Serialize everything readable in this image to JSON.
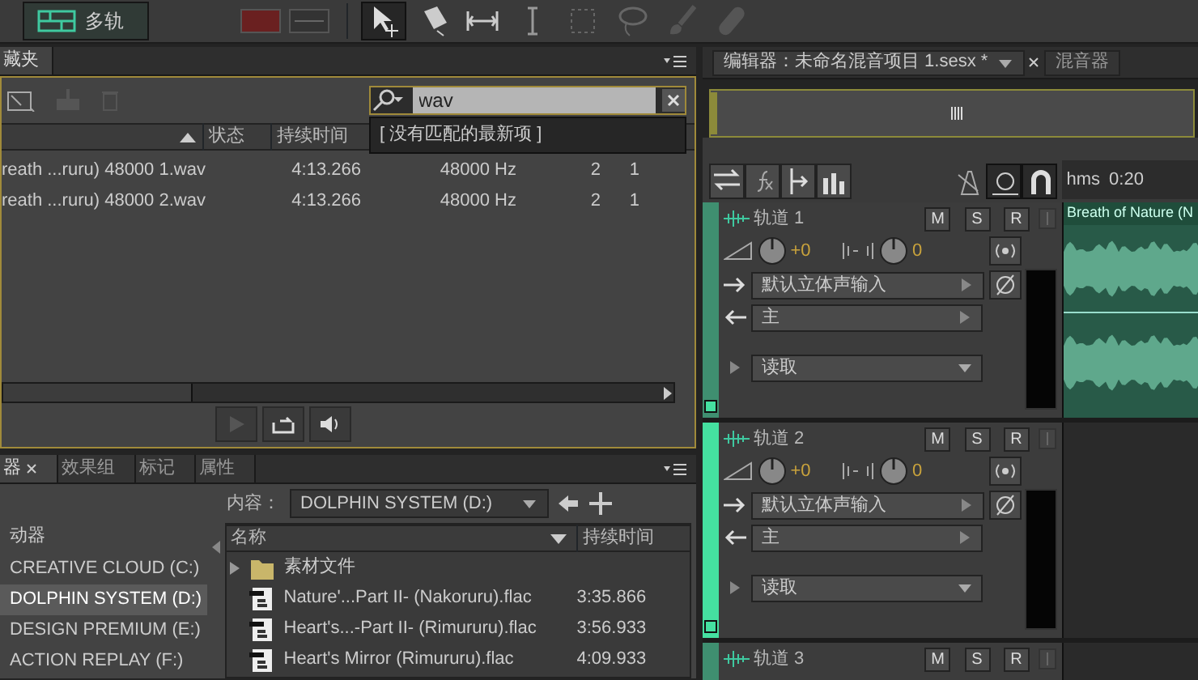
{
  "toolbar": {
    "multitrack": {
      "label": "多轨",
      "selected": true
    }
  },
  "files_panel": {
    "tab": "藏夹",
    "search": {
      "value": "wav",
      "suggestion": "[ 没有匹配的最新项 ]"
    },
    "columns": [
      "状态",
      "持续时间"
    ],
    "rows": [
      {
        "name": "reath ...ruru) 48000 1.wav",
        "duration": "4:13.266",
        "sample_rate": "48000 Hz",
        "channels": "2",
        "column_5": "1"
      },
      {
        "name": "reath ...ruru) 48000 2.wav",
        "duration": "4:13.266",
        "sample_rate": "48000 Hz",
        "channels": "2",
        "column_5": "1"
      }
    ]
  },
  "browser_panel": {
    "tabs": [
      {
        "label": "器",
        "selected": true
      },
      {
        "label": "效果组",
        "selected": false
      },
      {
        "label": "标记",
        "selected": false
      },
      {
        "label": "属性",
        "selected": false
      }
    ],
    "content_label": "内容：",
    "content_value": "DOLPHIN SYSTEM (D:)",
    "drives_header": "动器",
    "drives": [
      {
        "label": "CREATIVE CLOUD (C:)",
        "selected": false
      },
      {
        "label": "DOLPHIN SYSTEM (D:)",
        "selected": true
      },
      {
        "label": "DESIGN PREMIUM (E:)",
        "selected": false
      },
      {
        "label": "ACTION REPLAY (F:)",
        "selected": false
      }
    ],
    "columns": [
      "名称",
      "持续时间"
    ],
    "files": [
      {
        "kind": "folder",
        "name": "素材文件"
      },
      {
        "kind": "file",
        "name": "Nature'...Part II- (Nakoruru).flac",
        "duration": "3:35.866"
      },
      {
        "kind": "file",
        "name": "Heart's...-Part II- (Rimururu).flac",
        "duration": "3:56.933"
      },
      {
        "kind": "file",
        "name": "Heart's Mirror (Rimururu).flac",
        "duration": "4:09.933"
      }
    ]
  },
  "editor": {
    "tabs": [
      {
        "label": "编辑器：未命名混音项目 1.sesx *",
        "selected": true
      },
      {
        "label": "混音器",
        "selected": false
      }
    ],
    "ruler": [
      "hms",
      "0:20"
    ],
    "tracks": [
      {
        "name": "轨道 1",
        "selected": false,
        "buttons": [
          "M",
          "S",
          "R"
        ],
        "volume": "+0",
        "pan": "0",
        "input": "默认立体声输入",
        "output": "主",
        "automation": "读取",
        "clip": "Breath of Nature (N"
      },
      {
        "name": "轨道 2",
        "selected": true,
        "buttons": [
          "M",
          "S",
          "R"
        ],
        "volume": "+0",
        "pan": "0",
        "input": "默认立体声输入",
        "output": "主",
        "automation": "读取"
      },
      {
        "name": "轨道 3",
        "selected": false,
        "buttons": [
          "M",
          "S",
          "R"
        ]
      }
    ]
  }
}
